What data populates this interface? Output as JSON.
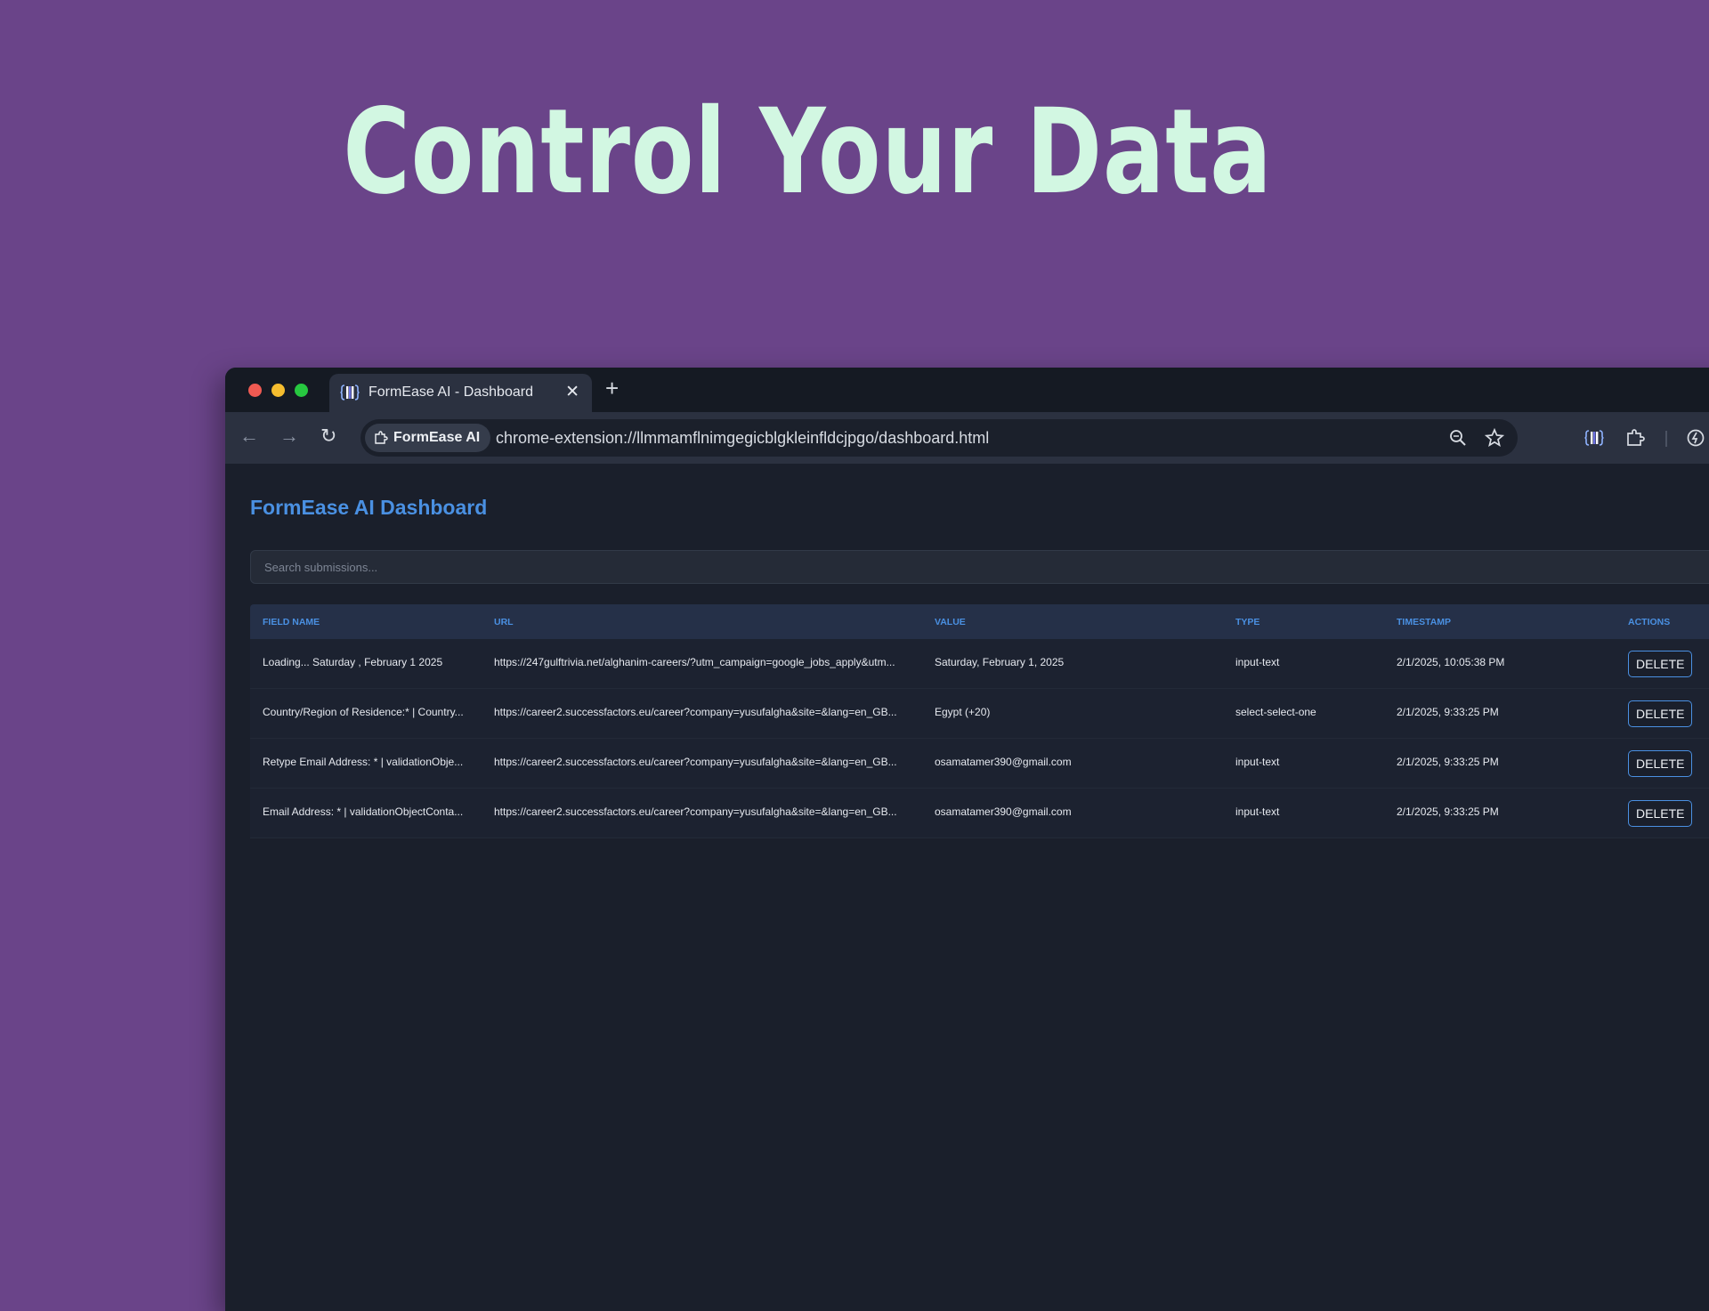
{
  "headline": "Control Your Data",
  "browser": {
    "tab_title": "FormEase AI - Dashboard",
    "tab_close": "✕",
    "new_tab": "+",
    "site_chip": "FormEase AI",
    "url": "chrome-extension://llmmamflnimgegicblgkleinfldcjpgo/dashboard.html",
    "icons": [
      "back-arrow-icon",
      "forward-arrow-icon",
      "reload-icon",
      "puzzle-icon",
      "zoom-icon",
      "star-icon",
      "formease-icon",
      "extensions-icon",
      "performance-icon"
    ]
  },
  "dashboard": {
    "title": "FormEase AI Dashboard",
    "search_placeholder": "Search submissions...",
    "columns": [
      "Field Name",
      "URL",
      "Value",
      "Type",
      "Timestamp",
      "Actions"
    ],
    "rows": [
      {
        "field_name": "Loading... Saturday , February 1 2025",
        "url": "https://247gulftrivia.net/alghanim-careers/?utm_campaign=google_jobs_apply&utm...",
        "value": "Saturday, February 1, 2025",
        "type": "input-text",
        "timestamp": "2/1/2025, 10:05:38 PM",
        "action": "DELETE"
      },
      {
        "field_name": "Country/Region of Residence:* | Country...",
        "url": "https://career2.successfactors.eu/career?company=yusufalgha&site=&lang=en_GB...",
        "value": "Egypt (+20)",
        "type": "select-select-one",
        "timestamp": "2/1/2025, 9:33:25 PM",
        "action": "DELETE"
      },
      {
        "field_name": "Retype Email Address: * | validationObje...",
        "url": "https://career2.successfactors.eu/career?company=yusufalgha&site=&lang=en_GB...",
        "value": "osamatamer390@gmail.com",
        "type": "input-text",
        "timestamp": "2/1/2025, 9:33:25 PM",
        "action": "DELETE"
      },
      {
        "field_name": "Email Address: * | validationObjectConta...",
        "url": "https://career2.successfactors.eu/career?company=yusufalgha&site=&lang=en_GB...",
        "value": "osamatamer390@gmail.com",
        "type": "input-text",
        "timestamp": "2/1/2025, 9:33:25 PM",
        "action": "DELETE"
      }
    ]
  },
  "colors": {
    "background": "#6a4489",
    "headline": "#d2f7e2",
    "accent": "#4a90e2",
    "page_bg": "#1a1f2b"
  }
}
